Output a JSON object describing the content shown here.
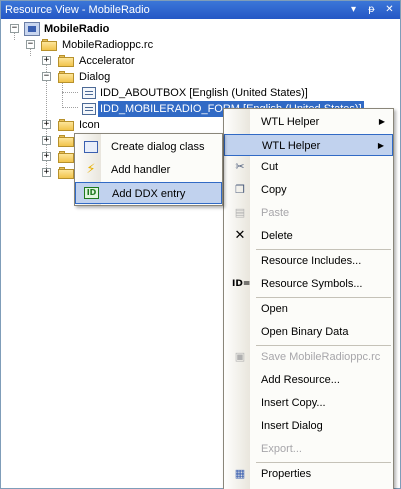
{
  "window": {
    "title": "Resource View - MobileRadio",
    "title_buttons": [
      "▾",
      "ᵽ",
      "✕"
    ]
  },
  "tree": {
    "root": "MobileRadio",
    "rc_file": "MobileRadioppc.rc",
    "folders": [
      "Accelerator",
      "Dialog",
      "Icon"
    ],
    "dialogs": [
      "IDD_ABOUTBOX [English (United States)]",
      "IDD_MOBILERADIO_FORM [English (United States)]"
    ]
  },
  "context_menu": {
    "items": {
      "wtl_helper_1": "WTL Helper",
      "wtl_helper_2": "WTL Helper",
      "cut": "Cut",
      "copy": "Copy",
      "paste": "Paste",
      "delete": "Delete",
      "resource_includes": "Resource Includes...",
      "resource_symbols": "Resource Symbols...",
      "open": "Open",
      "open_binary": "Open Binary Data",
      "save": "Save MobileRadioppc.rc",
      "add_resource": "Add Resource...",
      "insert_copy": "Insert Copy...",
      "insert_dialog": "Insert Dialog",
      "export": "Export...",
      "properties": "Properties"
    },
    "icon_labels": {
      "id_equals": "ID="
    }
  },
  "submenu": {
    "items": {
      "create_dialog_class": "Create dialog class",
      "add_handler": "Add handler",
      "add_ddx_entry": "Add DDX entry"
    },
    "icon_labels": {
      "ddx": "ID"
    }
  },
  "colors": {
    "titlebar": "#2457c5",
    "selection": "#316ac5",
    "menu_hover": "#c1d2ee"
  }
}
